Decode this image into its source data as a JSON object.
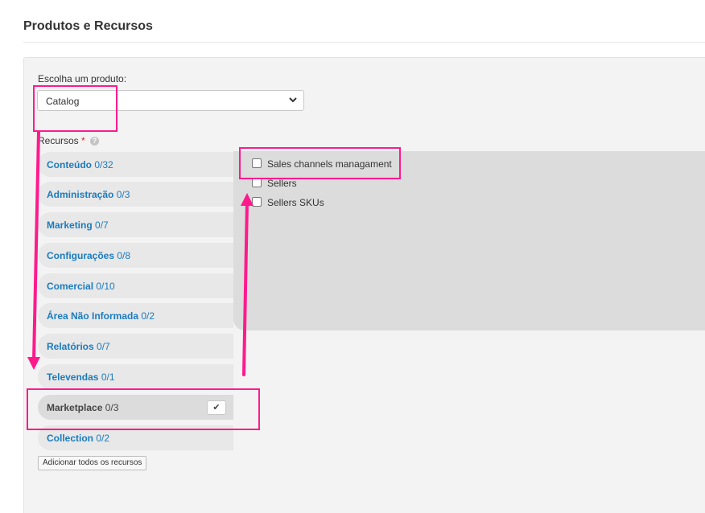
{
  "page": {
    "title": "Produtos e Recursos"
  },
  "product": {
    "label": "Escolha um produto:",
    "selected": "Catalog"
  },
  "resources": {
    "label": "Recursos",
    "required_mark": "*",
    "help_icon": "question-circle-icon",
    "items": [
      {
        "name": "Conteúdo",
        "count": "0/32"
      },
      {
        "name": "Administração",
        "count": "0/3"
      },
      {
        "name": "Marketing",
        "count": "0/7"
      },
      {
        "name": "Configurações",
        "count": "0/8"
      },
      {
        "name": "Comercial",
        "count": "0/10"
      },
      {
        "name": "Área Não Informada",
        "count": "0/2"
      },
      {
        "name": "Relatórios",
        "count": "0/7"
      },
      {
        "name": "Televendas",
        "count": "0/1"
      },
      {
        "name": "Marketplace",
        "count": "0/3",
        "active": true
      },
      {
        "name": "Collection",
        "count": "0/2"
      }
    ],
    "sub_items": [
      "Sales channels managament",
      "Sellers",
      "Sellers SKUs"
    ],
    "add_all_label": "Adicionar todos os recursos"
  },
  "colors": {
    "link": "#1a7bbf",
    "highlight": "#ff1a8c",
    "panel": "#f3f3f3"
  }
}
